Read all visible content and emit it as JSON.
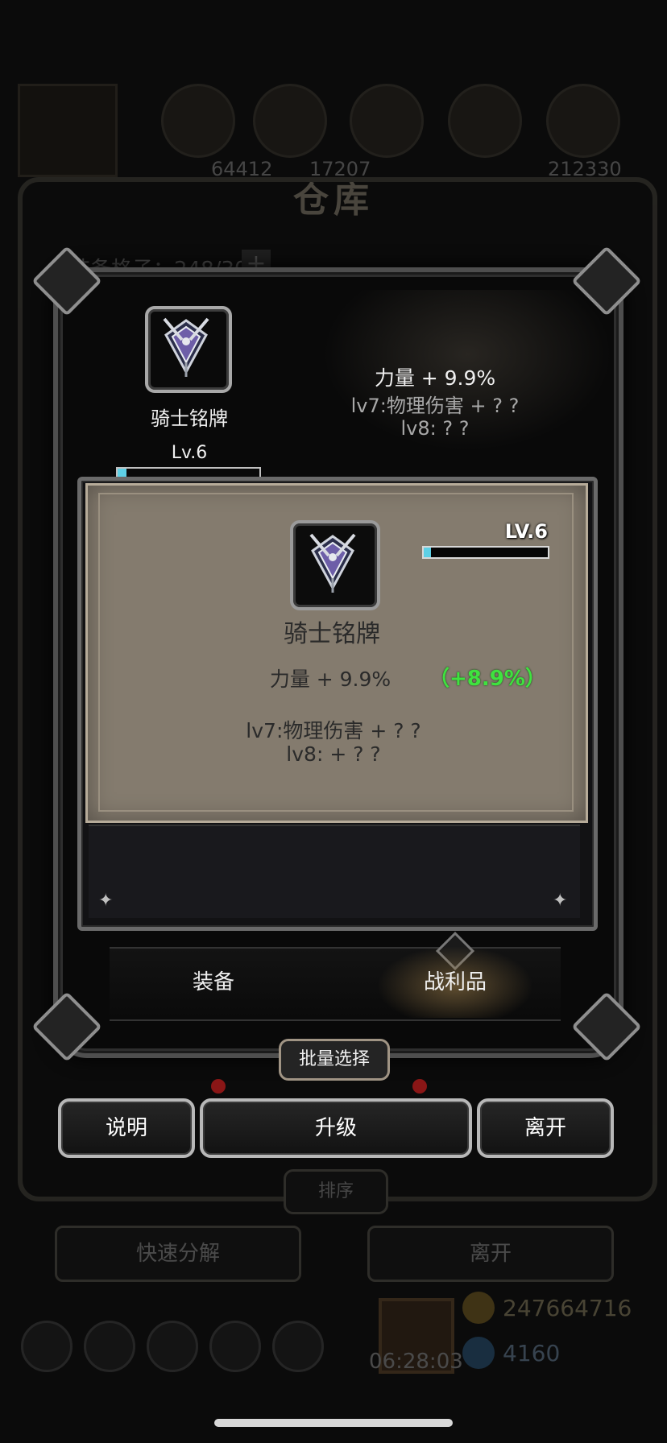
{
  "background": {
    "resource_left": "64412",
    "resource_mid": "17207",
    "resource_right": "212330",
    "title": "仓库",
    "capacity": "装备格子：248/300",
    "plus_label": "+",
    "sort_label": "排序",
    "quick_dismantle_label": "快速分解",
    "leave_label": "离开",
    "gold": "247664716",
    "gems": "4160",
    "timer": "06:28:03"
  },
  "item": {
    "name": "骑士铭牌",
    "level": "Lv.6",
    "level_progress": 0.06,
    "stats": [
      "力量 + 9.9%",
      "lv7:物理伤害 + ? ?",
      "lv8: ? ?"
    ]
  },
  "popup": {
    "level": "LV.6",
    "level_progress": 0.06,
    "name": "骑士铭牌",
    "stat": "力量 + 9.9%",
    "stat_delta": "（+8.9%）",
    "bonus_lines": [
      "lv7:物理伤害 + ? ?",
      "lv8: + ? ?"
    ]
  },
  "tabs": [
    {
      "label": "装备",
      "active": false
    },
    {
      "label": "战利品",
      "active": true
    }
  ],
  "batch_select_label": "批量选择",
  "actions": {
    "explain": "说明",
    "upgrade": "升级",
    "leave": "离开"
  },
  "colors": {
    "level_bar": "#5ed0e6",
    "delta_green": "#3fe23f",
    "card_bg": "#847b6e"
  },
  "icons": [
    "knight-emblem-icon",
    "sparkle-icon",
    "plus-icon"
  ]
}
